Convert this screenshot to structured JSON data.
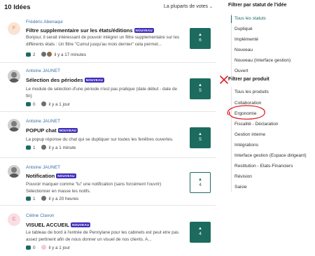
{
  "header": {
    "count_title": "10 Idées",
    "sort_label": "La pluparts de votes",
    "sort_chevron": "⌄"
  },
  "ideas": [
    {
      "author": "Frédéric Abenaqui",
      "avatar_initials": "F",
      "title": "Filtre supplementaire sur les états/éditions",
      "badge": "NOUVEAU",
      "desc": "Bonjour, il serait intéressant de pouvoir intégrer un filtre supplementaire sur les différents états : Un filtre \"Cumul jusqu'au mois dernier\" cela permet...",
      "comments": "2",
      "time": "il y a 17 minutes",
      "votes": "6",
      "vote_arrow": "▲"
    },
    {
      "author": "Antoine JAUNET",
      "title": "Sélection des périodes",
      "badge": "NOUVEAU",
      "desc": "Le module de sélection d'une période n'est pas pratique (date début - date de fin)",
      "comments": "0",
      "time": "il y a 1 jour",
      "votes": "5",
      "vote_arrow": "▲"
    },
    {
      "author": "Antoine JAUNET",
      "title": "POPUP chat",
      "badge": "NOUVEAU",
      "desc": "La popup réponse du chat qui se dupliquer sur toutes les fenêtres ouvertes.",
      "comments": "1",
      "time": "il y a 1 minute",
      "votes": "5",
      "vote_arrow": "▲"
    },
    {
      "author": "Antoine JAUNET",
      "title": "Notification",
      "badge": "NOUVEAU",
      "desc": "Pouvoir marquer comme \"lu\" une notification (sans forcément l'ouvrir) Sélectionner en masse les notifs.",
      "comments": "1",
      "time": "il y a 20 heures",
      "votes": "4",
      "vote_arrow": "▲"
    },
    {
      "author": "Céline Clavon",
      "avatar_initials": "C",
      "title": "VISUEL ACCUEIL",
      "badge": "NOUVEAU",
      "desc": "Le tableau de bord à l'entrée de Pennylane pour les cabinets est peut etre pas assez pertinent afin de nous donner un visuel de nos clients. A...",
      "comments": "0",
      "time": "il y a 1 jour",
      "votes": "4",
      "vote_arrow": "▲"
    }
  ],
  "sidebar": {
    "status_title": "Filtrer par statut de l'idée",
    "status_items": [
      "Tous les statuts",
      "Dupliqué",
      "Implémenté",
      "Nouveau",
      "Nouveau (Interface gestion)",
      "Ouvert"
    ],
    "product_title": "Filtrer par produit",
    "product_items": [
      "Tous les produits",
      "Collaboration",
      "Ergonomie",
      "Fiscalité - Déclaration",
      "Gestion interne",
      "Intégrations",
      "Interface gestion (Espace dirigeant)",
      "Restitution - Etats-Financiers",
      "Révision",
      "Saisie"
    ]
  },
  "colors": {
    "accent": "#1d6b5f",
    "badge": "#3e2fb8",
    "annotation": "#e0202a"
  }
}
